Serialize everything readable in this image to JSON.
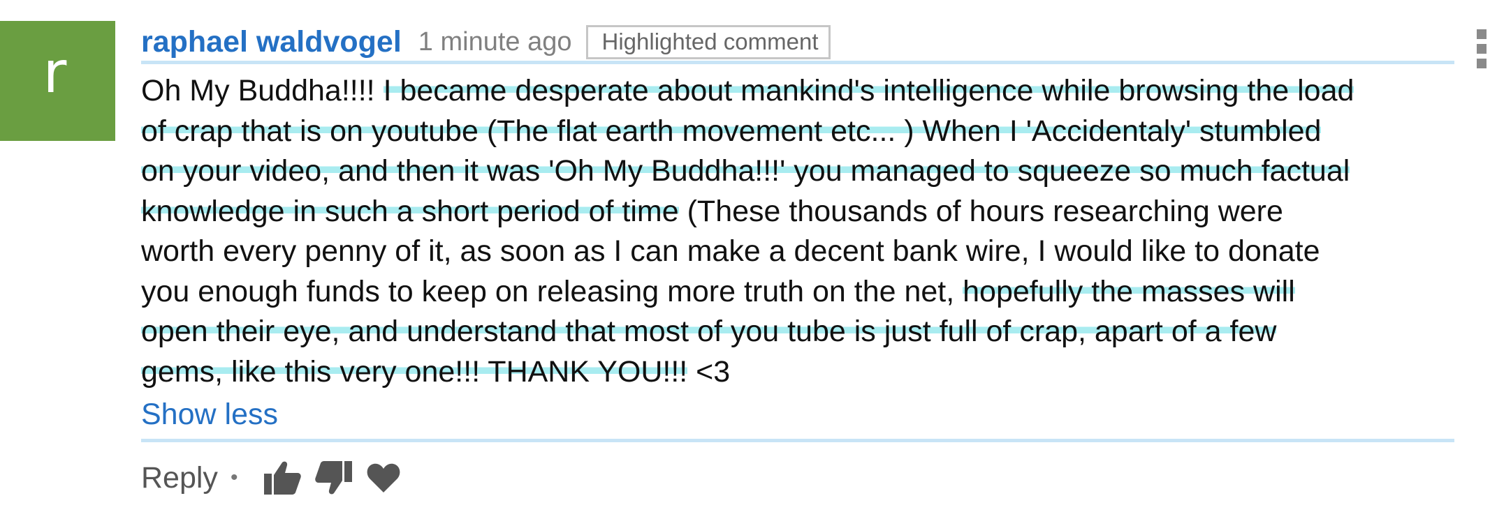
{
  "author": {
    "avatar_letter": "r",
    "avatar_color": "#6a9e41",
    "name": "raphael waldvogel",
    "time_ago": "1 minute ago",
    "badge": "Highlighted comment"
  },
  "comment": {
    "lines": [
      {
        "plain": "Oh My Buddha!!!! ",
        "highlight": "I became desperate about mankind's intelligence while browsing the load",
        "rest": ""
      },
      {
        "plain": "",
        "highlight": "of crap that is on youtube  (The flat earth movement etc... ) When I 'Accidentaly' stumbled",
        "rest": ""
      },
      {
        "plain": "",
        "highlight": "on your video, and then it was 'Oh My Buddha!!!' you managed to squeeze so much factual",
        "rest": ""
      },
      {
        "plain": "",
        "highlight": "knowledge in such a short period of time",
        "rest": " (These thousands of hours researching were"
      },
      {
        "plain": "worth every penny of it, as soon as I can make a decent bank wire, I would like to donate",
        "highlight": "",
        "rest": ""
      },
      {
        "plain": "you enough funds to keep on releasing more truth on the net, ",
        "highlight": "hopefully the masses will",
        "rest": ""
      },
      {
        "plain": "",
        "highlight": "open their eye, and understand that most of you tube is just full of crap, apart of a few",
        "rest": ""
      },
      {
        "plain": "",
        "highlight": "gems, like this very one!!! THANK YOU!!!",
        "rest": " <3"
      }
    ],
    "highlight_color": "#a9ecf0"
  },
  "toggle_label": "Show less",
  "actions": {
    "reply_label": "Reply",
    "separator": "•",
    "icons": [
      "thumbs-up-icon",
      "thumbs-down-icon",
      "heart-icon"
    ]
  },
  "colors": {
    "link": "#2470c4",
    "rule": "#c8e4f6"
  }
}
